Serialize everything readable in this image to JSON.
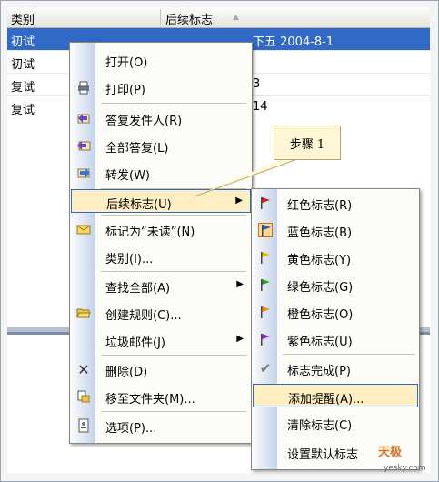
{
  "list": {
    "col1": "类别",
    "col2": "后续标志",
    "rows": [
      {
        "type": "初试",
        "value": "下五 2004-8-1",
        "selected": true
      },
      {
        "type": "初试",
        "value": ""
      },
      {
        "type": "复试",
        "value": "3"
      },
      {
        "type": "复试",
        "value": "14"
      }
    ]
  },
  "context_menu": {
    "items": [
      {
        "label": "打开(O)",
        "icon": "",
        "has_sub": false
      },
      {
        "label": "打印(P)",
        "icon": "printer-icon",
        "has_sub": false
      },
      {
        "label": "答复发件人(R)",
        "icon": "reply-icon",
        "has_sub": false
      },
      {
        "label": "全部答复(L)",
        "icon": "reply-all-icon",
        "has_sub": false
      },
      {
        "label": "转发(W)",
        "icon": "forward-icon",
        "has_sub": false
      },
      {
        "label": "后续标志(U)",
        "icon": "",
        "has_sub": true,
        "highlighted": true
      },
      {
        "label": "标记为“未读”(N)",
        "icon": "envelope-icon",
        "has_sub": false
      },
      {
        "label": "类别(I)...",
        "icon": "",
        "has_sub": false
      },
      {
        "label": "查找全部(A)",
        "icon": "",
        "has_sub": true
      },
      {
        "label": "创建规则(C)...",
        "icon": "folder-open-icon",
        "has_sub": false
      },
      {
        "label": "垃圾邮件(J)",
        "icon": "",
        "has_sub": true
      },
      {
        "label": "删除(D)",
        "icon": "delete-icon",
        "has_sub": false
      },
      {
        "label": "移至文件夹(M)...",
        "icon": "move-to-folder-icon",
        "has_sub": false
      },
      {
        "label": "选项(P)...",
        "icon": "options-icon",
        "has_sub": false
      }
    ]
  },
  "flag_menu": {
    "items": [
      {
        "label": "红色标志(R)",
        "icon": "red-flag-icon",
        "color": "#cc1f1f"
      },
      {
        "label": "蓝色标志(B)",
        "icon": "blue-flag-icon",
        "color": "#2b5bd6"
      },
      {
        "label": "黄色标志(Y)",
        "icon": "yellow-flag-icon",
        "color": "#e0c400"
      },
      {
        "label": "绿色标志(G)",
        "icon": "green-flag-icon",
        "color": "#2e9a2e"
      },
      {
        "label": "橙色标志(O)",
        "icon": "orange-flag-icon",
        "color": "#f08a1c"
      },
      {
        "label": "紫色标志(U)",
        "icon": "purple-flag-icon",
        "color": "#8a2fc8"
      },
      {
        "label": "标志完成(P)",
        "icon": "checkmark-icon",
        "color": "#777777"
      },
      {
        "label": "添加提醒(A)...",
        "icon": "",
        "color": "",
        "highlighted": true
      },
      {
        "label": "清除标志(C)",
        "icon": "",
        "color": ""
      },
      {
        "label": "设置默认标志",
        "icon": "",
        "color": ""
      }
    ]
  },
  "callout": {
    "text": "步骤 1"
  },
  "watermark": {
    "logo": "天极",
    "url": "yesky.com"
  }
}
